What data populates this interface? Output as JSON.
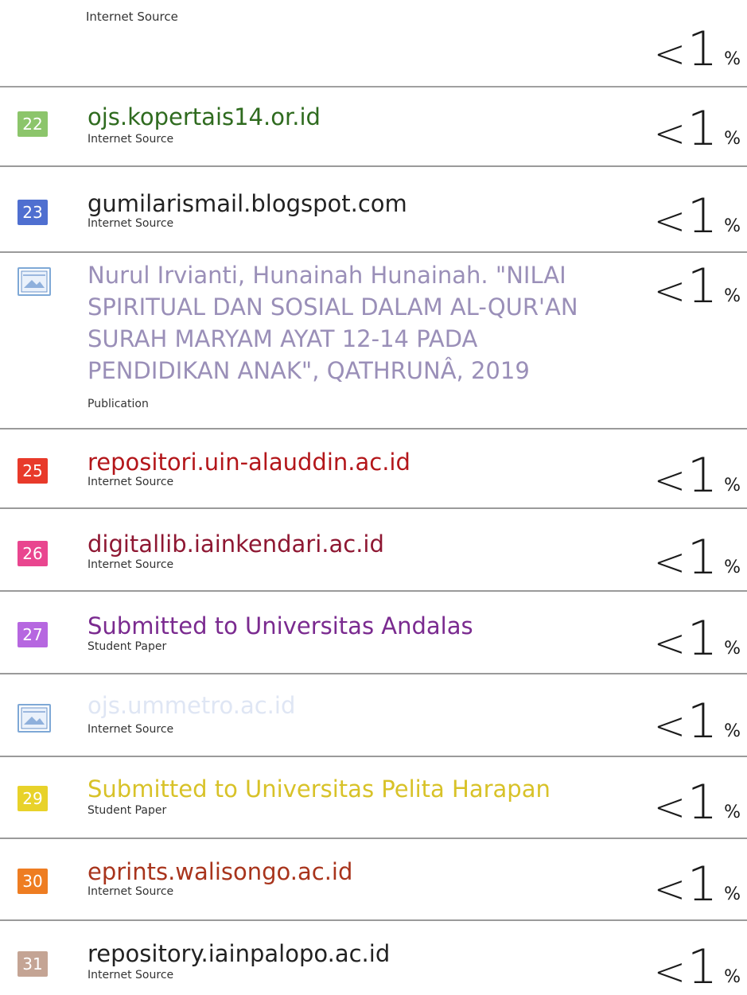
{
  "top": {
    "source_type": "Internet Source",
    "percent_prefix": "<",
    "percent_value": "1",
    "percent_unit": "%"
  },
  "entries": [
    {
      "number": "22",
      "title": "ojs.kopertais14.or.id",
      "source_type": "Internet Source",
      "badge_color": "#8cc56b",
      "title_color": "#2f6b1f"
    },
    {
      "number": "23",
      "title": "gumilarismail.blogspot.com",
      "source_type": "Internet Source",
      "badge_color": "#4f6fd0",
      "title_color": "#222222"
    },
    {
      "number": "",
      "title": "Nurul Irvianti, Hunainah Hunainah. \"NILAI SPIRITUAL DAN SOSIAL DALAM AL-QUR'AN SURAH MARYAM AYAT 12-14 PADA PENDIDIKAN ANAK\", QATHRUNÂ, 2019",
      "source_type": "Publication",
      "badge_color": "#ffffff",
      "title_color": "#9a8fb8"
    },
    {
      "number": "25",
      "title": "repositori.uin-alauddin.ac.id",
      "source_type": "Internet Source",
      "badge_color": "#e83a2a",
      "title_color": "#b3161a"
    },
    {
      "number": "26",
      "title": "digitallib.iainkendari.ac.id",
      "source_type": "Internet Source",
      "badge_color": "#e9468f",
      "title_color": "#8e1732"
    },
    {
      "number": "27",
      "title": "Submitted to Universitas Andalas",
      "source_type": "Student Paper",
      "badge_color": "#b667e0",
      "title_color": "#7a2a8f"
    },
    {
      "number": "",
      "title": "ojs.ummetro.ac.id",
      "source_type": "Internet Source",
      "badge_color": "#ffffff",
      "title_color": "#dfe6f4"
    },
    {
      "number": "29",
      "title": "Submitted to Universitas Pelita Harapan",
      "source_type": "Student Paper",
      "badge_color": "#e8d22a",
      "title_color": "#d8c228"
    },
    {
      "number": "30",
      "title": "eprints.walisongo.ac.id",
      "source_type": "Internet Source",
      "badge_color": "#ee7d22",
      "title_color": "#a8341c"
    },
    {
      "number": "31",
      "title": "repository.iainpalopo.ac.id",
      "source_type": "Internet Source",
      "badge_color": "#c4a494",
      "title_color": "#222222"
    }
  ],
  "percent": {
    "prefix": "<",
    "value": "1",
    "unit": "%"
  },
  "rule_color": "#9a9a9a"
}
